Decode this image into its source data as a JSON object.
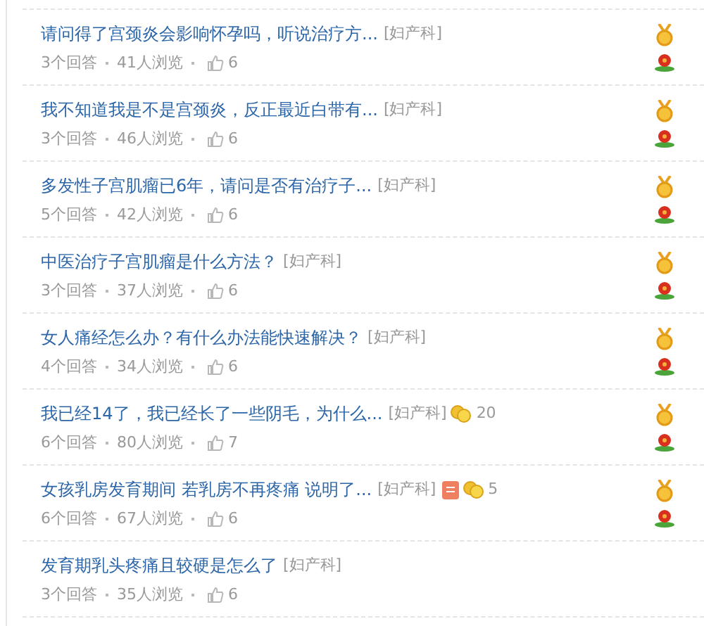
{
  "questions": [
    {
      "title": "请问得了宫颈炎会影响怀孕吗，听说治疗方...",
      "category": "[妇产科]",
      "answers": "3个回答",
      "views": "41人浏览",
      "likes": "6",
      "medal": true,
      "flower": true
    },
    {
      "title": "我不知道我是不是宫颈炎，反正最近白带有...",
      "category": "[妇产科]",
      "answers": "3个回答",
      "views": "46人浏览",
      "likes": "6",
      "medal": true,
      "flower": true
    },
    {
      "title": "多发性子宫肌瘤已6年，请问是否有治疗子...",
      "category": "[妇产科]",
      "answers": "5个回答",
      "views": "42人浏览",
      "likes": "6",
      "medal": true,
      "flower": true
    },
    {
      "title": "中医治疗子宫肌瘤是什么方法？",
      "category": "[妇产科]",
      "answers": "3个回答",
      "views": "37人浏览",
      "likes": "6",
      "medal": true,
      "flower": true
    },
    {
      "title": "女人痛经怎么办？有什么办法能快速解决？",
      "category": "[妇产科]",
      "answers": "4个回答",
      "views": "34人浏览",
      "likes": "6",
      "medal": true,
      "flower": true
    },
    {
      "title": "我已经14了，我已经长了一些阴毛，为什么...",
      "category": "[妇产科]",
      "reward": "20",
      "answers": "6个回答",
      "views": "80人浏览",
      "likes": "7",
      "medal": true,
      "flower": true
    },
    {
      "title": "女孩乳房发育期间 若乳房不再疼痛 说明了...",
      "category": "[妇产科]",
      "document": true,
      "reward": "5",
      "answers": "6个回答",
      "views": "67人浏览",
      "likes": "6",
      "medal": true,
      "flower": true
    },
    {
      "title": "发育期乳头疼痛且较硬是怎么了",
      "category": "[妇产科]",
      "answers": "3个回答",
      "views": "35人浏览",
      "likes": "6",
      "medal": false,
      "flower": false
    }
  ]
}
